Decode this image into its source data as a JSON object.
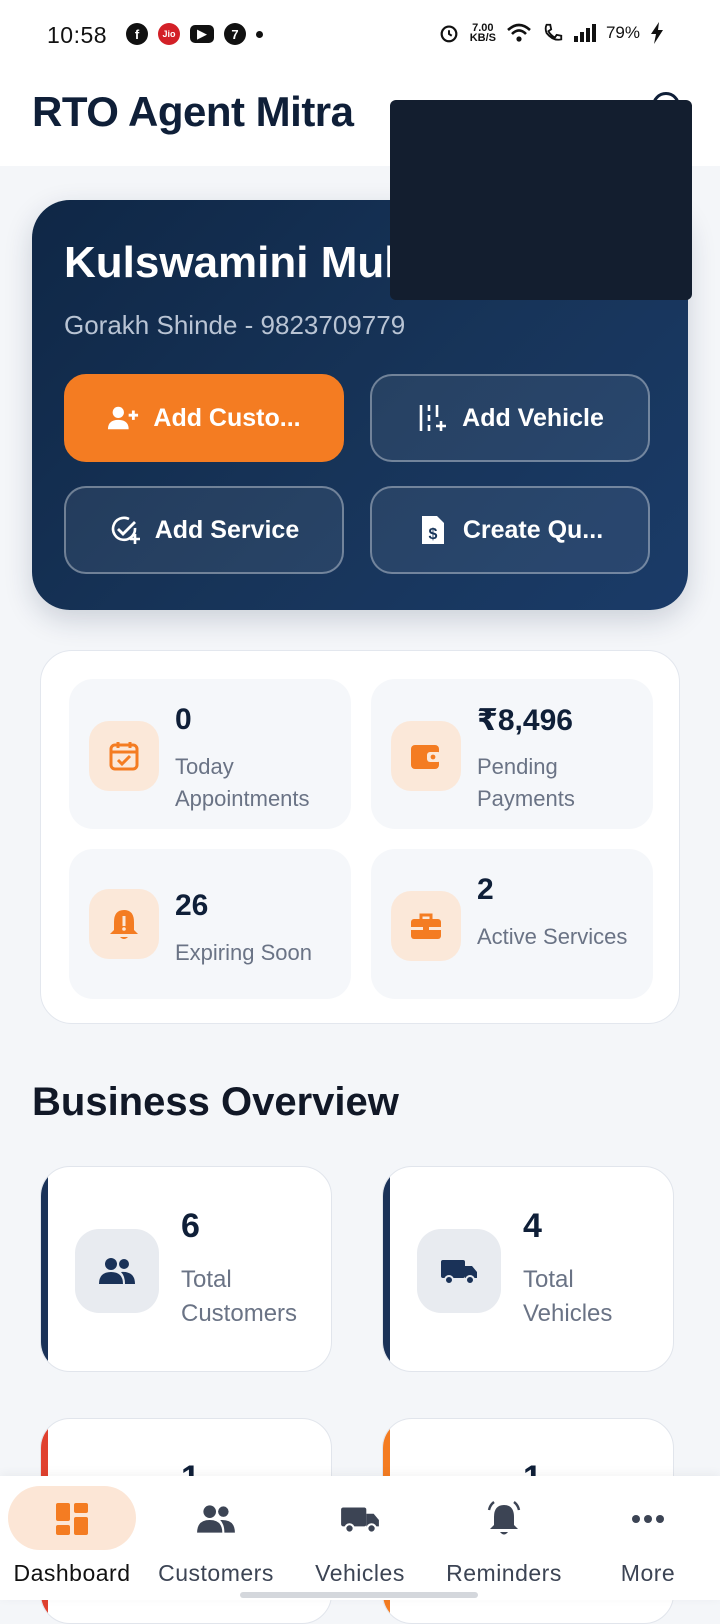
{
  "status_bar": {
    "time": "10:58",
    "speed_top": "7.00",
    "speed_unit": "KB/S",
    "battery": "79%",
    "left_icons": [
      "facebook-icon",
      "jio-icon",
      "youtube-icon",
      "settings-badge-icon"
    ],
    "right_icons": [
      "alarm-icon",
      "wifi-icon",
      "call-icon",
      "signal-icon",
      "charging-icon"
    ]
  },
  "header": {
    "title": "RTO Agent Mitra"
  },
  "hero": {
    "business_name": "Kulswamini Mult",
    "contact": "Gorakh Shinde - 9823709779",
    "buttons": [
      {
        "label": "Add Custo...",
        "icon": "add-person-icon"
      },
      {
        "label": "Add Vehicle",
        "icon": "add-vehicle-icon"
      },
      {
        "label": "Add Service",
        "icon": "add-service-icon"
      },
      {
        "label": "Create Qu...",
        "icon": "quotation-icon"
      }
    ],
    "colors": {
      "primary": "#f47c22",
      "gradient_start": "#0f2746",
      "gradient_end": "#1a3b68"
    }
  },
  "stats": [
    {
      "value": "0",
      "label": "Today Appointments",
      "icon": "calendar-check-icon"
    },
    {
      "value": "₹8,496",
      "label": "Pending Payments",
      "icon": "wallet-icon"
    },
    {
      "value": "26",
      "label": "Expiring Soon",
      "icon": "bell-alert-icon"
    },
    {
      "value": "2",
      "label": "Active Services",
      "icon": "briefcase-icon"
    }
  ],
  "overview": {
    "title": "Business Overview",
    "cards": [
      {
        "value": "6",
        "label": "Total Customers",
        "icon": "customers-icon"
      },
      {
        "value": "4",
        "label": "Total Vehicles",
        "icon": "truck-icon"
      },
      {
        "value": "1",
        "label": "",
        "icon": ""
      },
      {
        "value": "1",
        "label": "",
        "icon": ""
      }
    ]
  },
  "bottom_nav": [
    {
      "label": "Dashboard",
      "icon": "dashboard-icon",
      "active": true
    },
    {
      "label": "Customers",
      "icon": "customers-icon",
      "active": false
    },
    {
      "label": "Vehicles",
      "icon": "truck-icon",
      "active": false
    },
    {
      "label": "Reminders",
      "icon": "bell-ring-icon",
      "active": false
    },
    {
      "label": "More",
      "icon": "more-dots-icon",
      "active": false
    }
  ]
}
